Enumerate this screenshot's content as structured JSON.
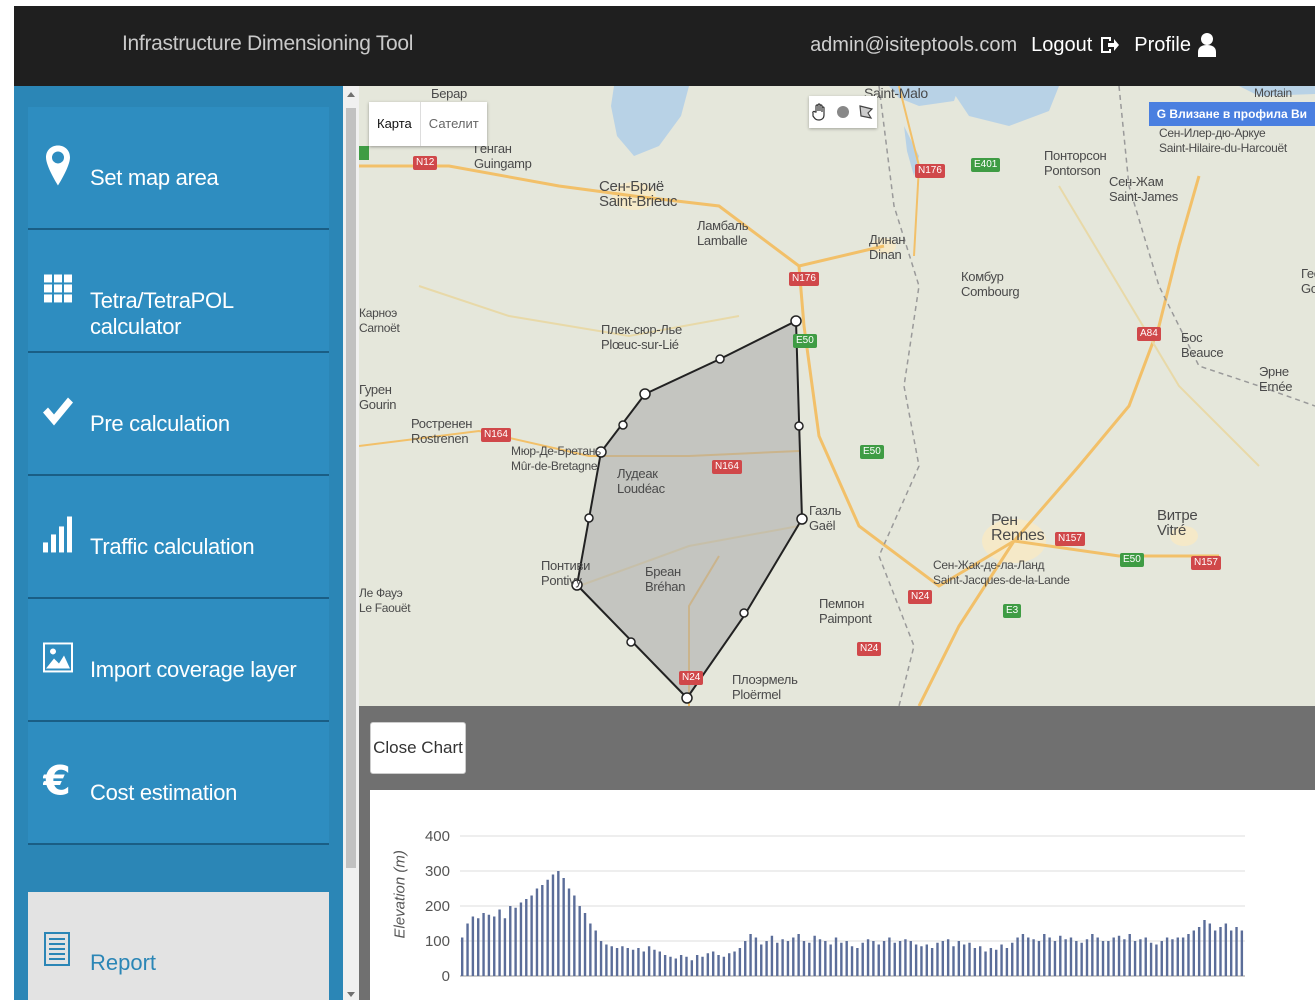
{
  "header": {
    "app_title": "Infrastructure Dimensioning Tool",
    "user_email": "admin@isiteptools.com",
    "logout_label": "Logout",
    "profile_label": "Profile"
  },
  "sidebar": {
    "items": [
      {
        "label": "Set map area",
        "icon": "map-marker-icon"
      },
      {
        "label": "Tetra/TetraPOL calculator",
        "icon": "grid-icon"
      },
      {
        "label": "Pre calculation",
        "icon": "check-icon"
      },
      {
        "label": "Traffic calculation",
        "icon": "bar-chart-icon"
      },
      {
        "label": "Import coverage layer",
        "icon": "image-icon"
      },
      {
        "label": "Cost estimation",
        "icon": "euro-icon"
      }
    ],
    "report_label": "Report"
  },
  "map": {
    "type_map": "Карта",
    "type_satellite": "Сателит",
    "google_badge": "G Влизане в профила Ви",
    "labels": [
      {
        "text": "Генган\nGuingamp"
      },
      {
        "text": "Сен-Бриё\nSaint-Brieuc"
      },
      {
        "text": "Ламбаль\nLamballe"
      },
      {
        "text": "Динан\nDinan"
      },
      {
        "text": "Понторсон\nPontorson"
      },
      {
        "text": "Сен-Жам\nSaint-James"
      },
      {
        "text": "Сен-Илер-дю-Аркуе\nSaint-Hilaire-du-Harcouët"
      },
      {
        "text": "Комбур\nCombourg"
      },
      {
        "text": "Плек-сюр-Лье\nPlœuc-sur-Lié"
      },
      {
        "text": "Ростренен\nRostrenen"
      },
      {
        "text": "Мюр-Де-Бретань\nMûr-de-Bretagne"
      },
      {
        "text": "Лудеак\nLoudéac"
      },
      {
        "text": "Газль\nGaël"
      },
      {
        "text": "Рен\nRennes"
      },
      {
        "text": "Сен-Жак-де-ла-Ланд\nSaint-Jacques-de-la-Lande"
      },
      {
        "text": "Витре\nVitré"
      },
      {
        "text": "Бос\nBeauce"
      },
      {
        "text": "Эрне\nErnée"
      },
      {
        "text": "Понтиви\nPontivy"
      },
      {
        "text": "Бреан\nBréhan"
      },
      {
        "text": "Пемпон\nPaimpont"
      },
      {
        "text": "Плоэрмель\nPloërmel"
      },
      {
        "text": "Ле Фауэ\nLe Faouët"
      },
      {
        "text": "Гурен\nGourin"
      },
      {
        "text": "Карноэ\nCarnoët"
      },
      {
        "text": "Saint-Malo"
      },
      {
        "text": "Mortain"
      },
      {
        "text": "Берар"
      },
      {
        "text": "Гео\nGo"
      }
    ],
    "roads": [
      {
        "text": "N12",
        "color": "red"
      },
      {
        "text": "N176",
        "color": "red"
      },
      {
        "text": "E401",
        "color": "green"
      },
      {
        "text": "N176",
        "color": "red"
      },
      {
        "text": "E50",
        "color": "green"
      },
      {
        "text": "A84",
        "color": "red"
      },
      {
        "text": "N164",
        "color": "red"
      },
      {
        "text": "N164",
        "color": "red"
      },
      {
        "text": "E50",
        "color": "green"
      },
      {
        "text": "N157",
        "color": "red"
      },
      {
        "text": "E50",
        "color": "green"
      },
      {
        "text": "N157",
        "color": "red"
      },
      {
        "text": "N24",
        "color": "red"
      },
      {
        "text": "E3",
        "color": "green"
      },
      {
        "text": "N24",
        "color": "red"
      },
      {
        "text": "N24",
        "color": "red"
      }
    ]
  },
  "chart_panel": {
    "close_label": "Close Chart"
  },
  "chart_data": {
    "type": "bar",
    "ylabel": "Elevation (m)",
    "xlabel": "",
    "yticks": [
      "400",
      "300",
      "200",
      "100",
      "0"
    ],
    "ylim": [
      0,
      400
    ],
    "values": [
      110,
      150,
      170,
      165,
      180,
      175,
      170,
      190,
      165,
      200,
      195,
      210,
      220,
      230,
      250,
      260,
      275,
      290,
      300,
      280,
      250,
      230,
      200,
      180,
      150,
      130,
      100,
      90,
      85,
      80,
      85,
      80,
      75,
      80,
      70,
      85,
      75,
      70,
      60,
      55,
      50,
      60,
      55,
      45,
      60,
      55,
      65,
      70,
      60,
      55,
      65,
      70,
      80,
      100,
      120,
      110,
      90,
      100,
      115,
      95,
      105,
      100,
      110,
      120,
      100,
      95,
      115,
      105,
      100,
      90,
      110,
      95,
      100,
      85,
      80,
      95,
      105,
      100,
      90,
      100,
      110,
      95,
      100,
      105,
      100,
      90,
      85,
      90,
      80,
      95,
      100,
      105,
      85,
      100,
      90,
      95,
      80,
      85,
      70,
      80,
      75,
      90,
      80,
      95,
      110,
      120,
      110,
      105,
      100,
      120,
      110,
      100,
      115,
      105,
      110,
      100,
      95,
      105,
      120,
      110,
      100,
      100,
      110,
      115,
      105,
      120,
      100,
      105,
      110,
      95,
      90,
      100,
      110,
      105,
      110,
      110,
      120,
      130,
      140,
      160,
      150,
      130,
      140,
      150,
      130,
      140,
      130
    ]
  },
  "colors": {
    "header_bg": "#1f1f1f",
    "sidebar_bg": "#2b86b6",
    "nav_item_bg": "#2e8dc0",
    "chart_panel_bg": "#707070",
    "polygon_fill": "#a9a9a9"
  }
}
